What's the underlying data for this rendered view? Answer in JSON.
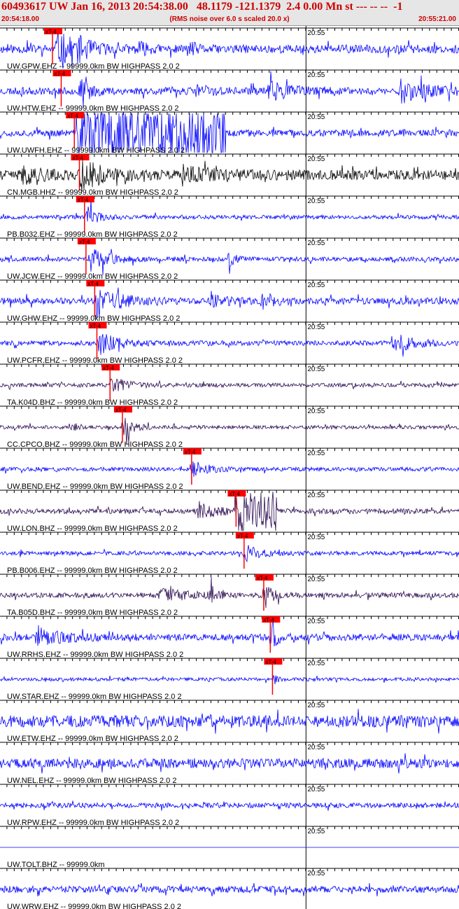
{
  "header": {
    "title": "60493617 UW Jan 16, 2013 20:54:38.00   48.1179 -121.1379  2.4 0.00 Mn st --- -- --  -1",
    "start_time": "20:54:18.00",
    "note": "(RMS noise over 6.0 s scaled 20.0 x)",
    "end_time": "20:55:21.00"
  },
  "chart_data": {
    "type": "line",
    "x_unit": "time",
    "xlim": [
      "20:54:18.00",
      "20:55:21.00"
    ],
    "minute_mark": {
      "time": "20:55:00",
      "label": "20:55"
    },
    "pick_label": "xT-4",
    "colors": {
      "blue": "#0000ff",
      "black": "#000000",
      "purple": "#2a0a50",
      "pick": "#ff0000"
    },
    "traces": [
      {
        "name": "UW.GPW.EHZ -- 99999.0km BW  HIGHPASS  2.0  2",
        "color": "blue",
        "pick_s": 7.2,
        "amp": 0.25,
        "seed": 11,
        "events": [
          [
            7.8,
            7.0,
            0.9
          ],
          [
            10.5,
            3.0,
            0.4
          ],
          [
            19.0,
            2.0,
            0.35
          ],
          [
            26.0,
            2.0,
            0.35
          ]
        ]
      },
      {
        "name": "UW.HTW.EHZ -- 99999.0km BW  HIGHPASS  2.0  2",
        "color": "blue",
        "pick_s": 8.4,
        "amp": 0.22,
        "seed": 23,
        "events": [
          [
            11.0,
            3.0,
            0.6
          ],
          [
            27.0,
            3.0,
            0.45
          ],
          [
            37.0,
            6.0,
            0.5
          ],
          [
            55.0,
            8.0,
            0.6
          ]
        ]
      },
      {
        "name": "UW.UWFH.EHZ -- 99999.0km BW  HIGHPASS  2.0  2",
        "color": "blue",
        "pick_s": 10.2,
        "amp": 0.2,
        "seed": 37,
        "events": [],
        "block": [
          10.4,
          31.0,
          1.6
        ]
      },
      {
        "name": "CN.MGB.HHZ -- 99999.0km BW  HIGHPASS  2.0  2",
        "color": "black",
        "pick_s": 10.9,
        "amp": 0.3,
        "seed": 41,
        "events": [
          [
            3.0,
            5.0,
            0.4
          ],
          [
            11.0,
            6.0,
            0.9
          ],
          [
            25.0,
            8.0,
            0.4
          ]
        ]
      },
      {
        "name": "PB.B032.EHZ -- 99999.0km BW  HIGHPASS  2.0  2",
        "color": "blue",
        "pick_s": 11.6,
        "amp": 0.12,
        "seed": 53,
        "events": [
          [
            12.0,
            3.0,
            0.55
          ]
        ]
      },
      {
        "name": "UW.JCW.EHZ -- 99999.0km BW  HIGHPASS  2.0  2",
        "color": "blue",
        "pick_s": 11.8,
        "amp": 0.13,
        "seed": 67,
        "events": [
          [
            12.3,
            6.0,
            0.65
          ],
          [
            31.5,
            1.5,
            0.5
          ]
        ]
      },
      {
        "name": "UW.GHW.EHZ -- 99999.0km BW  HIGHPASS  2.0  2",
        "color": "blue",
        "pick_s": 13.0,
        "amp": 0.2,
        "seed": 71,
        "events": [
          [
            13.2,
            6.0,
            0.95
          ],
          [
            29.0,
            3.0,
            0.45
          ],
          [
            36.0,
            3.0,
            0.45
          ]
        ]
      },
      {
        "name": "UW.PCFR.EHZ -- 99999.0km BW  HIGHPASS  2.0  2",
        "color": "blue",
        "pick_s": 13.3,
        "amp": 0.15,
        "seed": 83,
        "events": [
          [
            13.5,
            5.0,
            0.65
          ],
          [
            54.0,
            5.0,
            0.6
          ]
        ]
      },
      {
        "name": "TA.K04D.BHZ -- 99999.0km BW  HIGHPASS  2.0  2",
        "color": "purple",
        "pick_s": 15.1,
        "amp": 0.12,
        "seed": 97,
        "events": [
          [
            15.4,
            4.0,
            0.55
          ]
        ]
      },
      {
        "name": "CC.CPCO.BHZ -- 99999.0km BW  HIGHPASS  2.0  2",
        "color": "purple",
        "pick_s": 16.8,
        "amp": 0.11,
        "seed": 101,
        "events": [
          [
            16.9,
            3.0,
            0.6
          ],
          [
            10.0,
            2.0,
            0.2
          ]
        ]
      },
      {
        "name": "UW.BEND.EHZ -- 99999.0km BW  HIGHPASS  2.0  2",
        "color": "blue",
        "pick_s": 26.3,
        "amp": 0.12,
        "seed": 113,
        "events": [
          [
            26.4,
            4.0,
            0.55
          ]
        ]
      },
      {
        "name": "UW.LON.BHZ -- 99999.0km BW  HIGHPASS  2.0  2",
        "color": "purple",
        "pick_s": 32.4,
        "amp": 0.15,
        "seed": 127,
        "events": [
          [
            27.0,
            5.0,
            0.55
          ]
        ],
        "block": [
          32.2,
          38.0,
          1.3
        ]
      },
      {
        "name": "PB.B006.EHZ -- 99999.0km BW  HIGHPASS  2.0  2",
        "color": "blue",
        "pick_s": 33.5,
        "amp": 0.12,
        "seed": 131,
        "events": [
          [
            33.7,
            5.0,
            0.45
          ]
        ]
      },
      {
        "name": "TA.B05D.BHZ -- 99999.0km BW  HIGHPASS  2.0  2",
        "color": "purple",
        "pick_s": 36.2,
        "amp": 0.15,
        "seed": 149,
        "events": [
          [
            22.0,
            8.0,
            0.35
          ],
          [
            28.8,
            1.5,
            0.65
          ],
          [
            36.4,
            2.0,
            0.75
          ]
        ]
      },
      {
        "name": "UW.RRHS.EHZ -- 99999.0km BW  HIGHPASS  2.0  2",
        "color": "blue",
        "pick_s": 37.1,
        "amp": 0.2,
        "seed": 157,
        "events": [
          [
            5.0,
            8.0,
            0.45
          ],
          [
            37.3,
            2.0,
            0.6
          ]
        ]
      },
      {
        "name": "UW.STAR.EHZ -- 99999.0km BW  HIGHPASS  2.0  2",
        "color": "blue",
        "pick_s": 37.4,
        "amp": 0.1,
        "seed": 163,
        "events": [
          [
            37.6,
            1.0,
            0.35
          ]
        ]
      },
      {
        "name": "UW.ETW.EHZ -- 99999.0km BW  HIGHPASS  2.0  2",
        "color": "blue",
        "pick_s": null,
        "amp": 0.35,
        "seed": 173,
        "events": []
      },
      {
        "name": "UW.NEL.EHZ -- 99999.0km BW  HIGHPASS  2.0  2",
        "color": "blue",
        "pick_s": null,
        "amp": 0.28,
        "seed": 181,
        "events": []
      },
      {
        "name": "UW.RPW.EHZ -- 99999.0km BW  HIGHPASS  2.0  2",
        "color": "blue",
        "pick_s": null,
        "amp": 0.15,
        "seed": 191,
        "events": []
      },
      {
        "name": "UW.TOLT.BHZ -- 99999.0km",
        "color": "blue",
        "pick_s": null,
        "amp": 0.0,
        "seed": 193,
        "events": []
      },
      {
        "name": "UW.WRW.EHZ -- 99999.0km BW  HIGHPASS  2.0  2",
        "color": "blue",
        "pick_s": null,
        "amp": 0.2,
        "seed": 197,
        "events": []
      }
    ]
  }
}
